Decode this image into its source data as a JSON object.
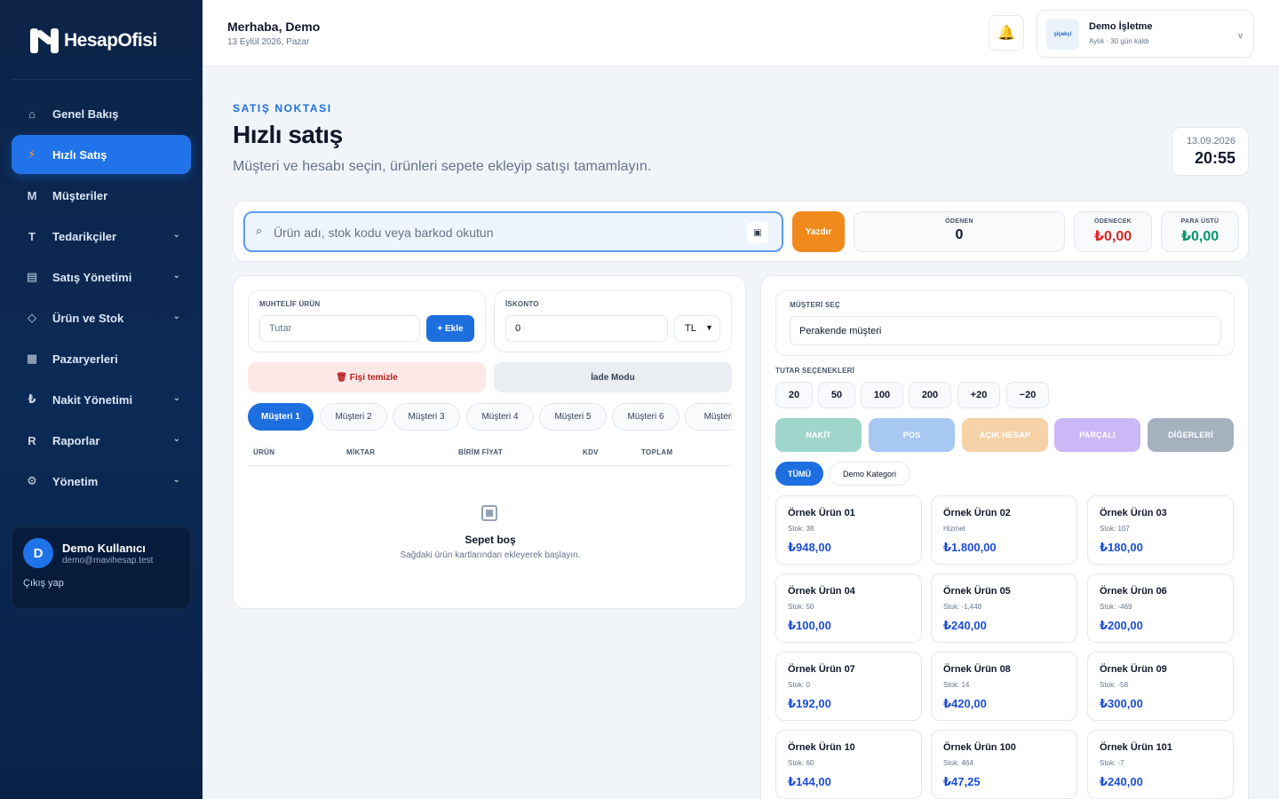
{
  "brand": {
    "name": "HesapOfisi"
  },
  "sidebar": {
    "items": [
      {
        "label": "Genel Bakış",
        "icon": "home-icon",
        "glyph": "⌂"
      },
      {
        "label": "Hızlı Satış",
        "icon": "bolt-icon",
        "glyph": "⚡"
      },
      {
        "label": "Müşteriler",
        "icon": "letter-m-icon",
        "glyph": "M"
      },
      {
        "label": "Tedarikçiler",
        "icon": "letter-t-icon",
        "glyph": "T"
      },
      {
        "label": "Satış Yönetimi",
        "icon": "receipt-icon",
        "glyph": "▤"
      },
      {
        "label": "Ürün ve Stok",
        "icon": "diamond-icon",
        "glyph": "◇"
      },
      {
        "label": "Pazaryerleri",
        "icon": "cart-icon",
        "glyph": "🛒"
      },
      {
        "label": "Nakit Yönetimi",
        "icon": "lira-icon",
        "glyph": "₺"
      },
      {
        "label": "Raporlar",
        "icon": "letter-r-icon",
        "glyph": "R"
      },
      {
        "label": "Yönetim",
        "icon": "gear-icon",
        "glyph": "⚙"
      }
    ],
    "user": {
      "initial": "D",
      "name": "Demo Kullanıcı",
      "email": "demo@mavihesap.test",
      "logout": "Çıkış yap"
    }
  },
  "topbar": {
    "greeting": "Merhaba, Demo",
    "date": "13 Eylül 2026, Pazar",
    "business": {
      "logo_text": "çiçekçi",
      "name": "Demo İşletme",
      "plan": "Aylık · 30 gün kaldı",
      "chevron": "v"
    }
  },
  "header": {
    "kicker": "SATIŞ NOKTASI",
    "title": "Hızlı satış",
    "subtitle": "Müşteri ve hesabı seçin, ürünleri sepete ekleyip satışı tamamlayın.",
    "clock_date": "13.09.2026",
    "clock_time": "20:55"
  },
  "search": {
    "placeholder": "Ürün adı, stok kodu veya barkod okutun",
    "print": "Yazdır"
  },
  "totals": {
    "paid_label": "ÖDENEN",
    "paid": "0",
    "due_label": "ÖDENECEK",
    "due": "₺0,00",
    "change_label": "PARA ÜSTÜ",
    "change": "₺0,00"
  },
  "cart": {
    "misc_label": "MUHTELİF ÜRÜN",
    "misc_placeholder": "Tutar",
    "add": "+ Ekle",
    "discount_label": "İSKONTO",
    "discount_value": "0",
    "discount_unit": "TL",
    "clear": "🗑 Fişi temizle",
    "return_mode": "İade Modu",
    "tabs": [
      "Müşteri 1",
      "Müşteri 2",
      "Müşteri 3",
      "Müşteri 4",
      "Müşteri 5",
      "Müşteri 6",
      "Müşteri"
    ],
    "columns": [
      "ÜRÜN",
      "MİKTAR",
      "BİRİM FİYAT",
      "KDV",
      "TOPLAM"
    ],
    "empty_title": "Sepet boş",
    "empty_sub": "Sağdaki ürün kartlarından ekleyerek başlayın."
  },
  "checkout": {
    "customer_label": "MÜŞTERİ SEÇ",
    "customer_value": "Perakende müşteri",
    "amount_label": "TUTAR SEÇENEKLERİ",
    "amounts": [
      "20",
      "50",
      "100",
      "200",
      "+20",
      "−20"
    ],
    "payments": [
      {
        "label": "NAKİT",
        "color": "#9fd6cc"
      },
      {
        "label": "POS",
        "color": "#a8c8f4"
      },
      {
        "label": "AÇIK HESAP",
        "color": "#f6d2a8"
      },
      {
        "label": "PARÇALI",
        "color": "#cbb8f6"
      },
      {
        "label": "DİĞERLERİ",
        "color": "#a6b1bf"
      }
    ],
    "categories": [
      "TÜMÜ",
      "Demo Kategori"
    ],
    "products": [
      {
        "name": "Örnek Ürün 01",
        "stock": "Stok: 38",
        "price": "₺948,00"
      },
      {
        "name": "Örnek Ürün 02",
        "stock": "Hizmet",
        "price": "₺1.800,00"
      },
      {
        "name": "Örnek Ürün 03",
        "stock": "Stok: 107",
        "price": "₺180,00"
      },
      {
        "name": "Örnek Ürün 04",
        "stock": "Stok: 50",
        "price": "₺100,00"
      },
      {
        "name": "Örnek Ürün 05",
        "stock": "Stok: -1,448",
        "price": "₺240,00"
      },
      {
        "name": "Örnek Ürün 06",
        "stock": "Stok: -469",
        "price": "₺200,00"
      },
      {
        "name": "Örnek Ürün 07",
        "stock": "Stok: 0",
        "price": "₺192,00"
      },
      {
        "name": "Örnek Ürün 08",
        "stock": "Stok: 14",
        "price": "₺420,00"
      },
      {
        "name": "Örnek Ürün 09",
        "stock": "Stok: -58",
        "price": "₺300,00"
      },
      {
        "name": "Örnek Ürün 10",
        "stock": "Stok: 60",
        "price": "₺144,00"
      },
      {
        "name": "Örnek Ürün 100",
        "stock": "Stok: 464",
        "price": "₺47,25"
      },
      {
        "name": "Örnek Ürün 101",
        "stock": "Stok: -7",
        "price": "₺240,00"
      }
    ]
  },
  "colors": {
    "accent": "#1d6fe0",
    "print": "#f08a1c",
    "due": "#dc2626",
    "change": "#059669"
  }
}
